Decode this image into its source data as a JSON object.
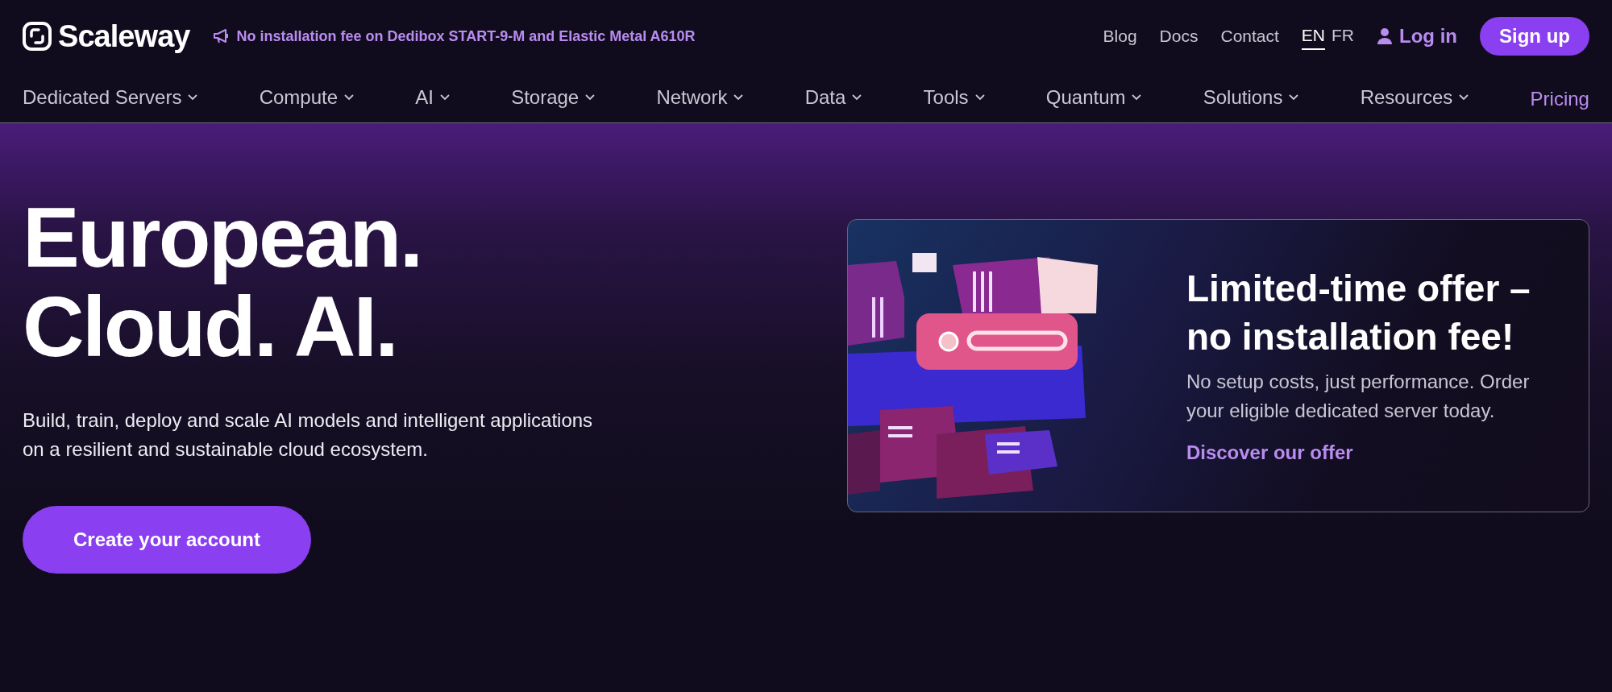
{
  "header": {
    "brand": "Scaleway",
    "announcement": "No installation fee on Dedibox START-9-M and Elastic Metal A610R",
    "links": [
      "Blog",
      "Docs",
      "Contact"
    ],
    "languages": [
      {
        "label": "EN",
        "selected": true
      },
      {
        "label": "FR",
        "selected": false
      }
    ],
    "login": "Log in",
    "signup": "Sign up"
  },
  "nav": [
    {
      "label": "Dedicated Servers",
      "kind": "menu"
    },
    {
      "label": "Compute",
      "kind": "menu"
    },
    {
      "label": "AI",
      "kind": "menu"
    },
    {
      "label": "Storage",
      "kind": "menu"
    },
    {
      "label": "Network",
      "kind": "menu"
    },
    {
      "label": "Data",
      "kind": "menu"
    },
    {
      "label": "Tools",
      "kind": "menu"
    },
    {
      "label": "Quantum",
      "kind": "menu"
    },
    {
      "label": "Solutions",
      "kind": "menu"
    },
    {
      "label": "Resources",
      "kind": "menu"
    },
    {
      "label": "Pricing",
      "kind": "link"
    }
  ],
  "hero": {
    "title_lines": [
      "European.",
      "Cloud. AI."
    ],
    "subtitle": "Build, train, deploy and scale AI models and intelligent applications on a resilient and sustainable cloud ecosystem.",
    "cta": "Create your account"
  },
  "offer": {
    "title": "Limited-time offer – no installation fee!",
    "body": "No setup costs, just performance. Order your eligible dedicated server today.",
    "link": "Discover our offer"
  }
}
